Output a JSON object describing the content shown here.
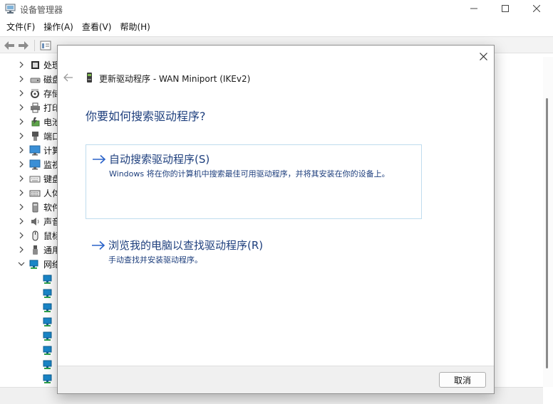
{
  "window": {
    "title": "设备管理器",
    "controls": [
      "minimize-icon",
      "maximize-icon",
      "close-icon"
    ]
  },
  "menubar": {
    "items": [
      {
        "label": "文件(F)"
      },
      {
        "label": "操作(A)"
      },
      {
        "label": "查看(V)"
      },
      {
        "label": "帮助(H)"
      }
    ]
  },
  "toolbar": {
    "icons": [
      "back-arrow-icon",
      "forward-arrow-icon",
      "properties-icon",
      "show-hidden-icon",
      "help-icon",
      "list-view-icon",
      "print-icon",
      "monitor-icon",
      "update-driver-icon",
      "uninstall-icon",
      "scan-hardware-icon"
    ]
  },
  "tree": {
    "items": [
      {
        "label": "处理",
        "icon": "processor-icon",
        "expanded": false
      },
      {
        "label": "磁盘",
        "icon": "disk-drive-icon",
        "expanded": false
      },
      {
        "label": "存储",
        "icon": "storage-controller-icon",
        "expanded": false
      },
      {
        "label": "打印",
        "icon": "printer-icon",
        "expanded": false
      },
      {
        "label": "电池",
        "icon": "battery-icon",
        "expanded": false
      },
      {
        "label": "端口",
        "icon": "port-icon",
        "expanded": false
      },
      {
        "label": "计算",
        "icon": "computer-icon",
        "expanded": false
      },
      {
        "label": "监视",
        "icon": "monitor-icon",
        "expanded": false
      },
      {
        "label": "键盘",
        "icon": "keyboard-icon",
        "expanded": false
      },
      {
        "label": "人体",
        "icon": "hid-icon",
        "expanded": false
      },
      {
        "label": "软件",
        "icon": "software-device-icon",
        "expanded": false
      },
      {
        "label": "声音",
        "icon": "sound-icon",
        "expanded": false
      },
      {
        "label": "鼠标",
        "icon": "mouse-icon",
        "expanded": false
      },
      {
        "label": "通用",
        "icon": "usb-icon",
        "expanded": false
      },
      {
        "label": "网络",
        "icon": "network-adapter-icon",
        "expanded": true
      }
    ],
    "network_children_count": 8
  },
  "dialog": {
    "title": "更新驱动程序 - WAN Miniport (IKEv2)",
    "question": "你要如何搜索驱动程序?",
    "options": [
      {
        "title": "自动搜索驱动程序(S)",
        "description": "Windows 将在你的计算机中搜索最佳可用驱动程序，并将其安装在你的设备上。"
      },
      {
        "title": "浏览我的电脑以查找驱动程序(R)",
        "description": "手动查找并安装驱动程序。"
      }
    ],
    "cancel_label": "取消"
  },
  "colors": {
    "accent": "#1e3f7d",
    "option_border": "#bfdcee",
    "arrow": "#2a62c9",
    "network_icon": "#1a86c8"
  }
}
